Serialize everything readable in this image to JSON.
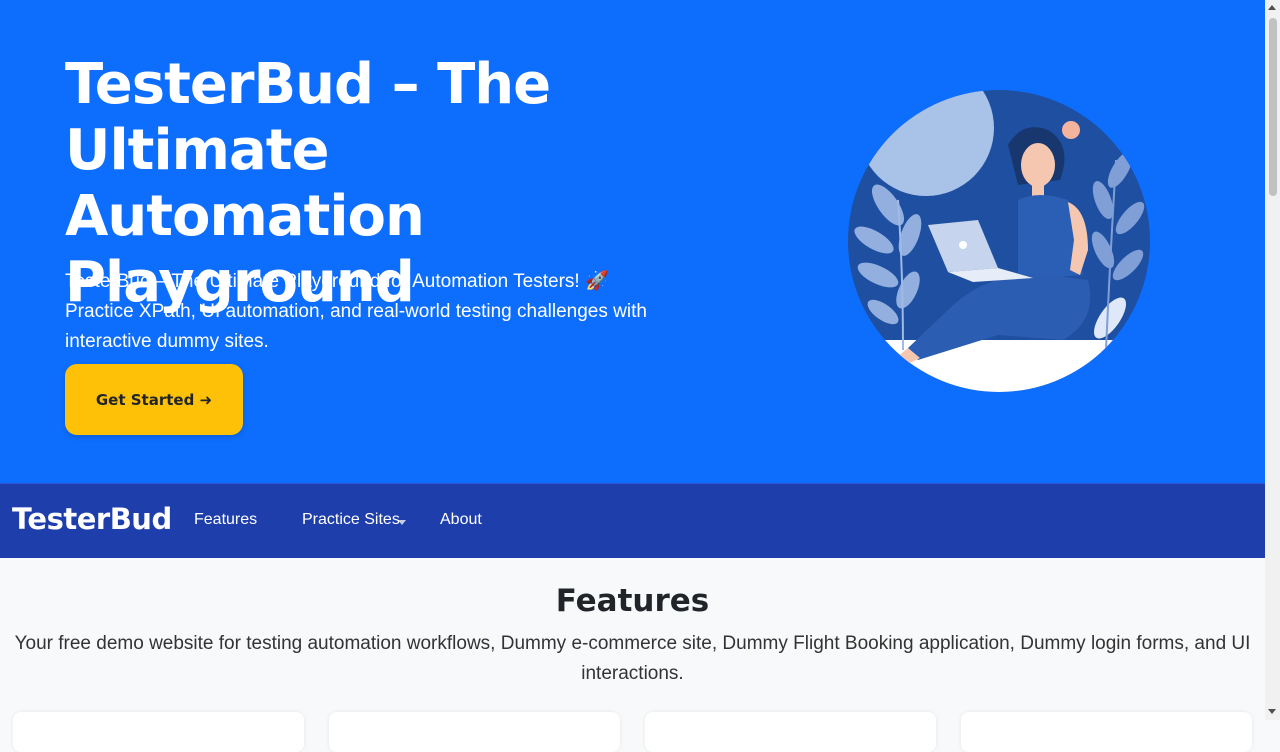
{
  "hero": {
    "title": "TesterBud – The Ultimate Automation Playground",
    "subtitle": "TesterBud – The Ultimate Playground for Automation Testers! 🚀 Practice XPath, UI automation, and real-world testing challenges with interactive dummy sites.",
    "cta_label": "Get Started ➜"
  },
  "navbar": {
    "brand": "TesterBud",
    "links": [
      {
        "label": "Features"
      },
      {
        "label": "Practice Sites"
      },
      {
        "label": "About"
      }
    ]
  },
  "features": {
    "title": "Features",
    "description": "Your free demo website for testing automation workflows, Dummy e-commerce site, Dummy Flight Booking application, Dummy login forms, and UI interactions."
  },
  "colors": {
    "hero_bg": "#0d6efd",
    "navbar_bg": "#1e3eac",
    "cta_bg": "#ffc107",
    "page_bg": "#f8f9fa"
  },
  "icons": {
    "hero_illustration": "woman-with-laptop-illustration",
    "dropdown": "caret-down-icon"
  }
}
